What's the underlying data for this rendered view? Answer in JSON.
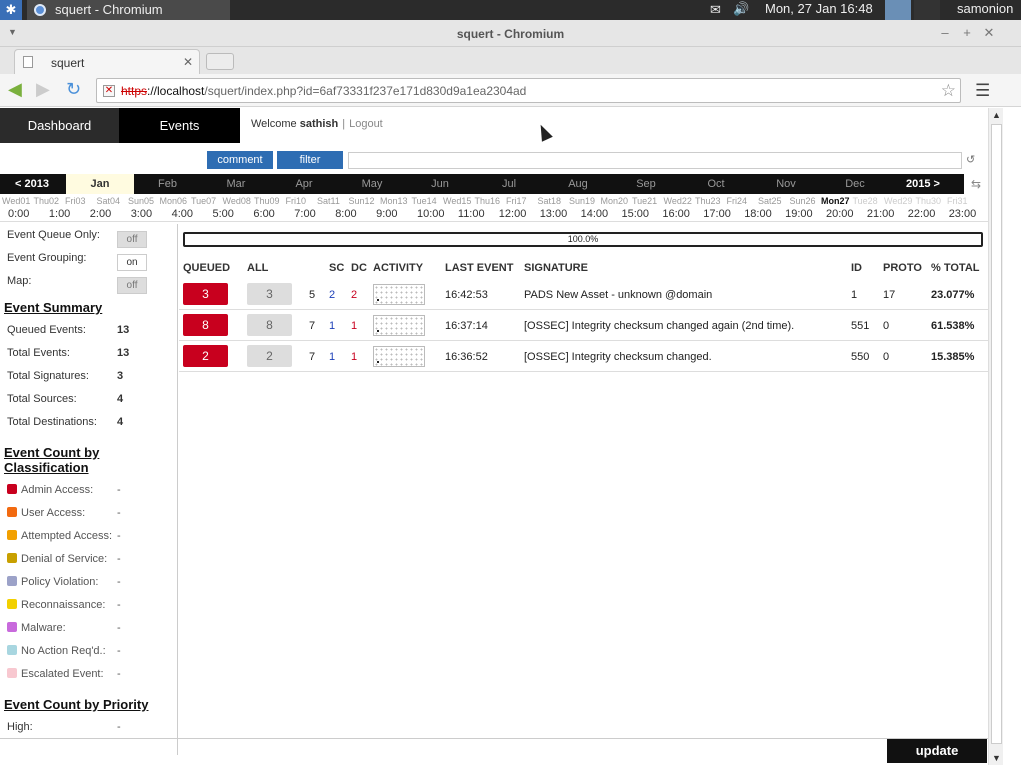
{
  "os": {
    "task_title": "squert - Chromium",
    "clock": "Mon, 27 Jan  16:48",
    "user": "samonion"
  },
  "window": {
    "title": "squert - Chromium"
  },
  "browser": {
    "tab_title": "squert",
    "url_scheme": "https",
    "url_host": "://localhost",
    "url_path": "/squert/index.php?id=6af73331f237e171d830d9a1ea2304ad"
  },
  "nav": {
    "tabs": [
      {
        "label": "Dashboard",
        "active": false
      },
      {
        "label": "Events",
        "active": true
      }
    ],
    "welcome": "Welcome",
    "username": "sathish",
    "separator": "|",
    "logout": "Logout"
  },
  "filter": {
    "comment_label": "comment",
    "filter_label": "filter",
    "input_value": ""
  },
  "months": {
    "prev": "< 2013",
    "next": "2015 >",
    "items": [
      "Jan",
      "Feb",
      "Mar",
      "Apr",
      "May",
      "Jun",
      "Jul",
      "Aug",
      "Sep",
      "Oct",
      "Nov",
      "Dec"
    ],
    "selected": "Jan"
  },
  "days": [
    "Wed01",
    "Thu02",
    "Fri03",
    "Sat04",
    "Sun05",
    "Mon06",
    "Tue07",
    "Wed08",
    "Thu09",
    "Fri10",
    "Sat11",
    "Sun12",
    "Mon13",
    "Tue14",
    "Wed15",
    "Thu16",
    "Fri17",
    "Sat18",
    "Sun19",
    "Mon20",
    "Tue21",
    "Wed22",
    "Thu23",
    "Fri24",
    "Sat25",
    "Sun26",
    "Mon27",
    "Tue28",
    "Wed29",
    "Thu30",
    "Fri31"
  ],
  "today": "Mon27",
  "hours": [
    "0:00",
    "1:00",
    "2:00",
    "3:00",
    "4:00",
    "5:00",
    "6:00",
    "7:00",
    "8:00",
    "9:00",
    "10:00",
    "11:00",
    "12:00",
    "13:00",
    "14:00",
    "15:00",
    "16:00",
    "17:00",
    "18:00",
    "19:00",
    "20:00",
    "21:00",
    "22:00",
    "23:00"
  ],
  "sidebar": {
    "toggles": [
      {
        "label": "Event Queue Only:",
        "state": "off"
      },
      {
        "label": "Event Grouping:",
        "state": "on"
      },
      {
        "label": "Map:",
        "state": "off"
      }
    ],
    "summary_title": "Event Summary",
    "summary": [
      {
        "label": "Queued Events:",
        "value": "13"
      },
      {
        "label": "Total Events:",
        "value": "13"
      },
      {
        "label": "Total Signatures:",
        "value": "3"
      },
      {
        "label": "Total Sources:",
        "value": "4"
      },
      {
        "label": "Total Destinations:",
        "value": "4"
      }
    ],
    "class_title_1": "Event Count by",
    "class_title_2": "Classification",
    "classes": [
      {
        "label": "Admin Access:",
        "value": "-",
        "color": "#c8001e"
      },
      {
        "label": "User Access:",
        "value": "-",
        "color": "#f26a10"
      },
      {
        "label": "Attempted Access:",
        "value": "-",
        "color": "#f2a000"
      },
      {
        "label": "Denial of Service:",
        "value": "-",
        "color": "#c8a000"
      },
      {
        "label": "Policy Violation:",
        "value": "-",
        "color": "#9ca2c8"
      },
      {
        "label": "Reconnaissance:",
        "value": "-",
        "color": "#f2d000"
      },
      {
        "label": "Malware:",
        "value": "-",
        "color": "#c86adc"
      },
      {
        "label": "No Action Req'd.:",
        "value": "-",
        "color": "#a8d6e0"
      },
      {
        "label": "Escalated Event:",
        "value": "-",
        "color": "#f8c8d0"
      }
    ],
    "priority_title": "Event Count by Priority",
    "priority_first": "High:",
    "priority_first_value": "-"
  },
  "main": {
    "progress_label": "100.0%",
    "progress_value": 1.0,
    "headers": {
      "queued": "QUEUED",
      "all": "ALL",
      "sc": "SC",
      "dc": "DC",
      "activity": "ACTIVITY",
      "last_event": "LAST EVENT",
      "signature": "SIGNATURE",
      "id": "ID",
      "proto": "PROTO",
      "total": "% TOTAL"
    },
    "rows": [
      {
        "queued": "3",
        "all": "3",
        "count": "5",
        "sc": "2",
        "dc": "2",
        "last_event": "16:42:53",
        "signature": "PADS New Asset - unknown @domain",
        "id": "1",
        "proto": "17",
        "total": "23.077%"
      },
      {
        "queued": "8",
        "all": "8",
        "count": "7",
        "sc": "1",
        "dc": "1",
        "last_event": "16:37:14",
        "signature": "[OSSEC] Integrity checksum changed again (2nd time).",
        "id": "551",
        "proto": "0",
        "total": "61.538%"
      },
      {
        "queued": "2",
        "all": "2",
        "count": "7",
        "sc": "1",
        "dc": "1",
        "last_event": "16:36:52",
        "signature": "[OSSEC] Integrity checksum changed.",
        "id": "550",
        "proto": "0",
        "total": "15.385%"
      }
    ]
  },
  "footer": {
    "update_label": "update"
  },
  "icons": {
    "launcher": "launcher-icon",
    "mail": "mail-icon",
    "volume": "volume-icon",
    "back": "back-arrow-icon",
    "forward": "forward-arrow-icon",
    "reload": "reload-icon",
    "star": "bookmark-star-icon",
    "menu": "menu-icon"
  },
  "colors": {
    "queued_red": "#c8001e",
    "accent_blue": "#2e6db3",
    "nav_dark": "#111111"
  }
}
